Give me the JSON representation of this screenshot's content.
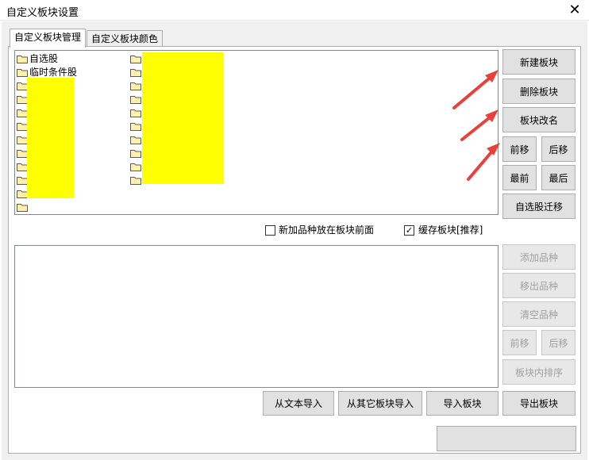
{
  "window": {
    "title": "自定义板块设置",
    "close_glyph": "✕"
  },
  "tabs": [
    {
      "label": "自定义板块管理",
      "active": true
    },
    {
      "label": "自定义板块颜色",
      "active": false
    }
  ],
  "block_list": {
    "visible_labels": [
      "自选股",
      "临时条件股"
    ],
    "highlight_color": "#ffff00"
  },
  "block_buttons": {
    "new": "新建板块",
    "delete": "删除板块",
    "rename": "板块改名",
    "move_up": "前移",
    "move_down": "后移",
    "move_first": "最前",
    "move_last": "最后",
    "migrate": "自选股迁移"
  },
  "options": {
    "add_front": {
      "label": "新加品种放在板块前面",
      "checked": false
    },
    "cache": {
      "label": "缓存板块[推荐]",
      "checked": true,
      "mark": "✓"
    }
  },
  "stock_buttons": {
    "add": "添加品种",
    "remove": "移出品种",
    "clear": "清空品种",
    "move_up": "前移",
    "move_down": "后移",
    "sort": "板块内排序"
  },
  "bottom_buttons": {
    "import_text": "从文本导入",
    "import_other": "从其它板块导入",
    "import_block": "导入板块",
    "export_block": "导出板块"
  },
  "annotation_color": "#e8413b"
}
